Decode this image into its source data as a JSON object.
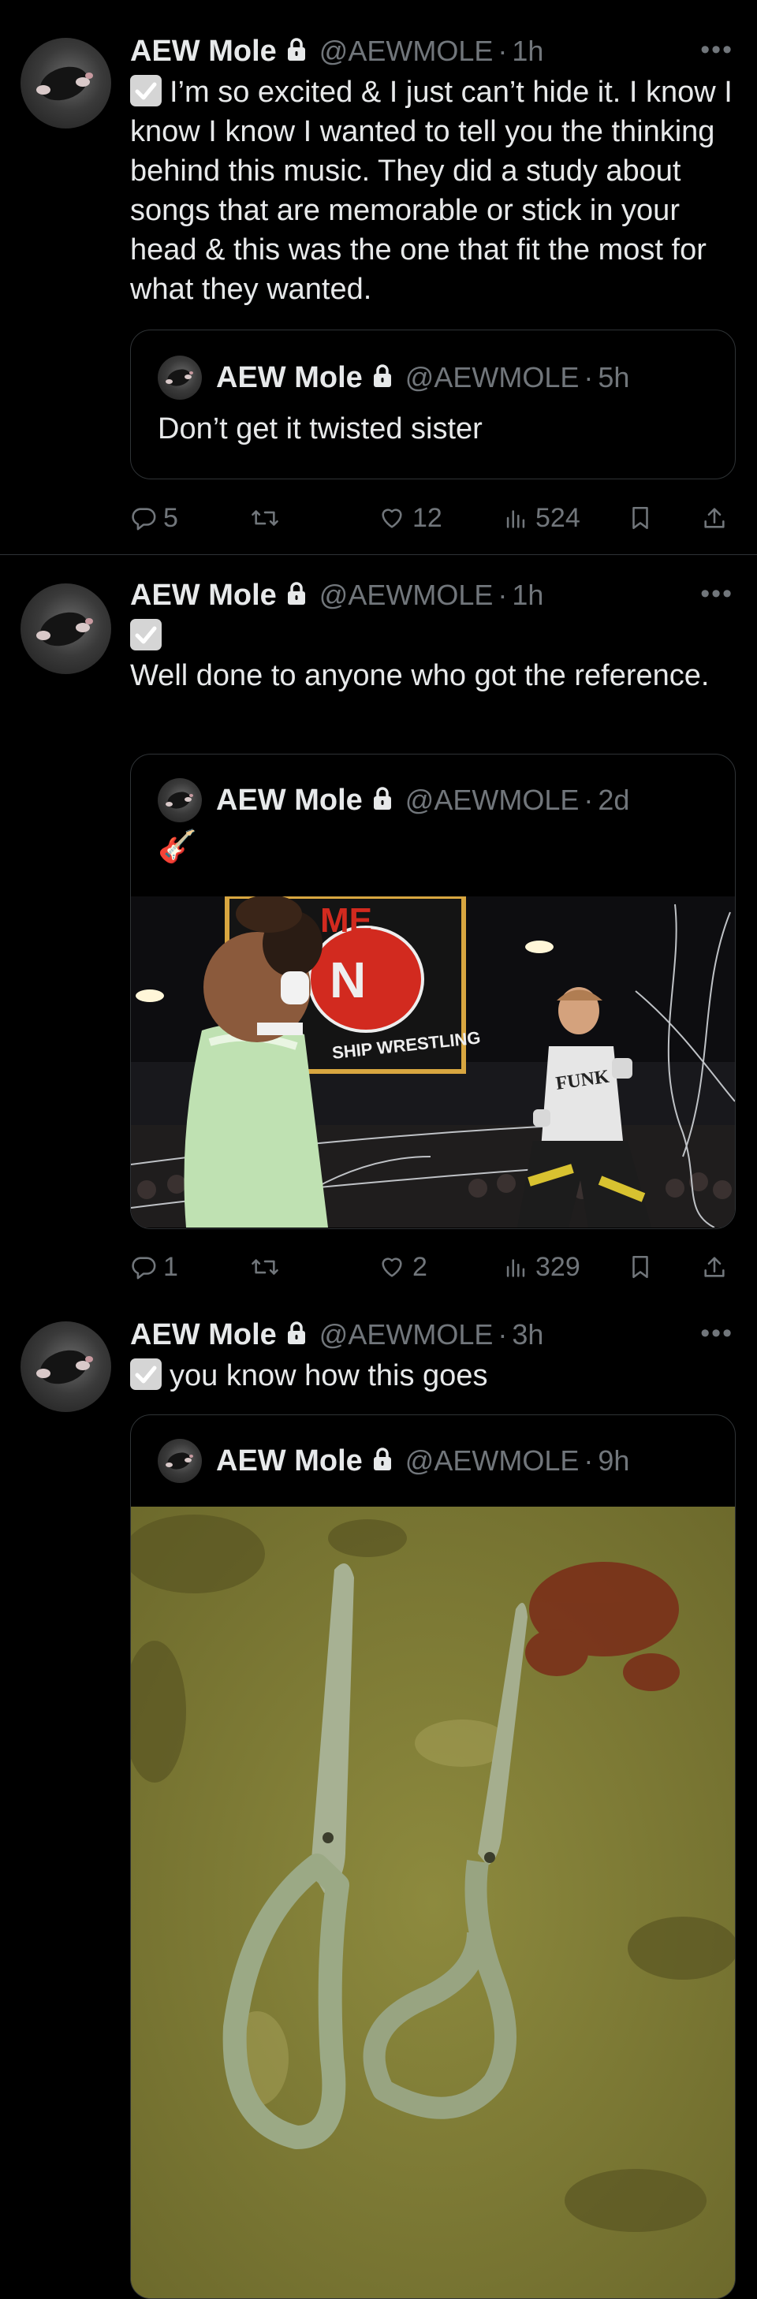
{
  "tweets": [
    {
      "name": "AEW Mole",
      "handle": "@AEWMOLE",
      "time": "1h",
      "text": "I’m so excited & I just can’t hide it. I know I know I know I wanted to tell you the thinking behind this music. They did a study about songs that are memorable or stick in your head & this was the one that fit the most for what they wanted.",
      "quote": {
        "name": "AEW Mole",
        "handle": "@AEWMOLE",
        "time": "5h",
        "text": "Don’t get it twisted sister"
      },
      "replies": "5",
      "reposts": "",
      "likes": "12",
      "views": "524"
    },
    {
      "name": "AEW Mole",
      "handle": "@AEWMOLE",
      "time": "1h",
      "text": "Well done to anyone who got the reference.",
      "quote": {
        "name": "AEW Mole",
        "handle": "@AEWMOLE",
        "time": "2d",
        "text": "🎸"
      },
      "photo_texts": {
        "banner_top": "ME",
        "banner_bottom": "SHIP WRESTLING",
        "shirt": "FUNK"
      },
      "replies": "1",
      "reposts": "",
      "likes": "2",
      "views": "329"
    },
    {
      "name": "AEW Mole",
      "handle": "@AEWMOLE",
      "time": "3h",
      "text": "you know how this goes",
      "quote": {
        "name": "AEW Mole",
        "handle": "@AEWMOLE",
        "time": "9h"
      }
    }
  ],
  "icons": {
    "avatar": "mole-avatar",
    "lock": "lock-icon",
    "check": "check-box-emoji",
    "more": "more-icon",
    "reply": "reply-icon",
    "repost": "repost-icon",
    "like": "heart-icon",
    "views": "views-icon",
    "bookmark": "bookmark-icon",
    "share": "share-icon"
  },
  "colors": {
    "background": "#000000",
    "text": "#e7e9ea",
    "muted": "#71767b",
    "border": "#2f3336"
  }
}
